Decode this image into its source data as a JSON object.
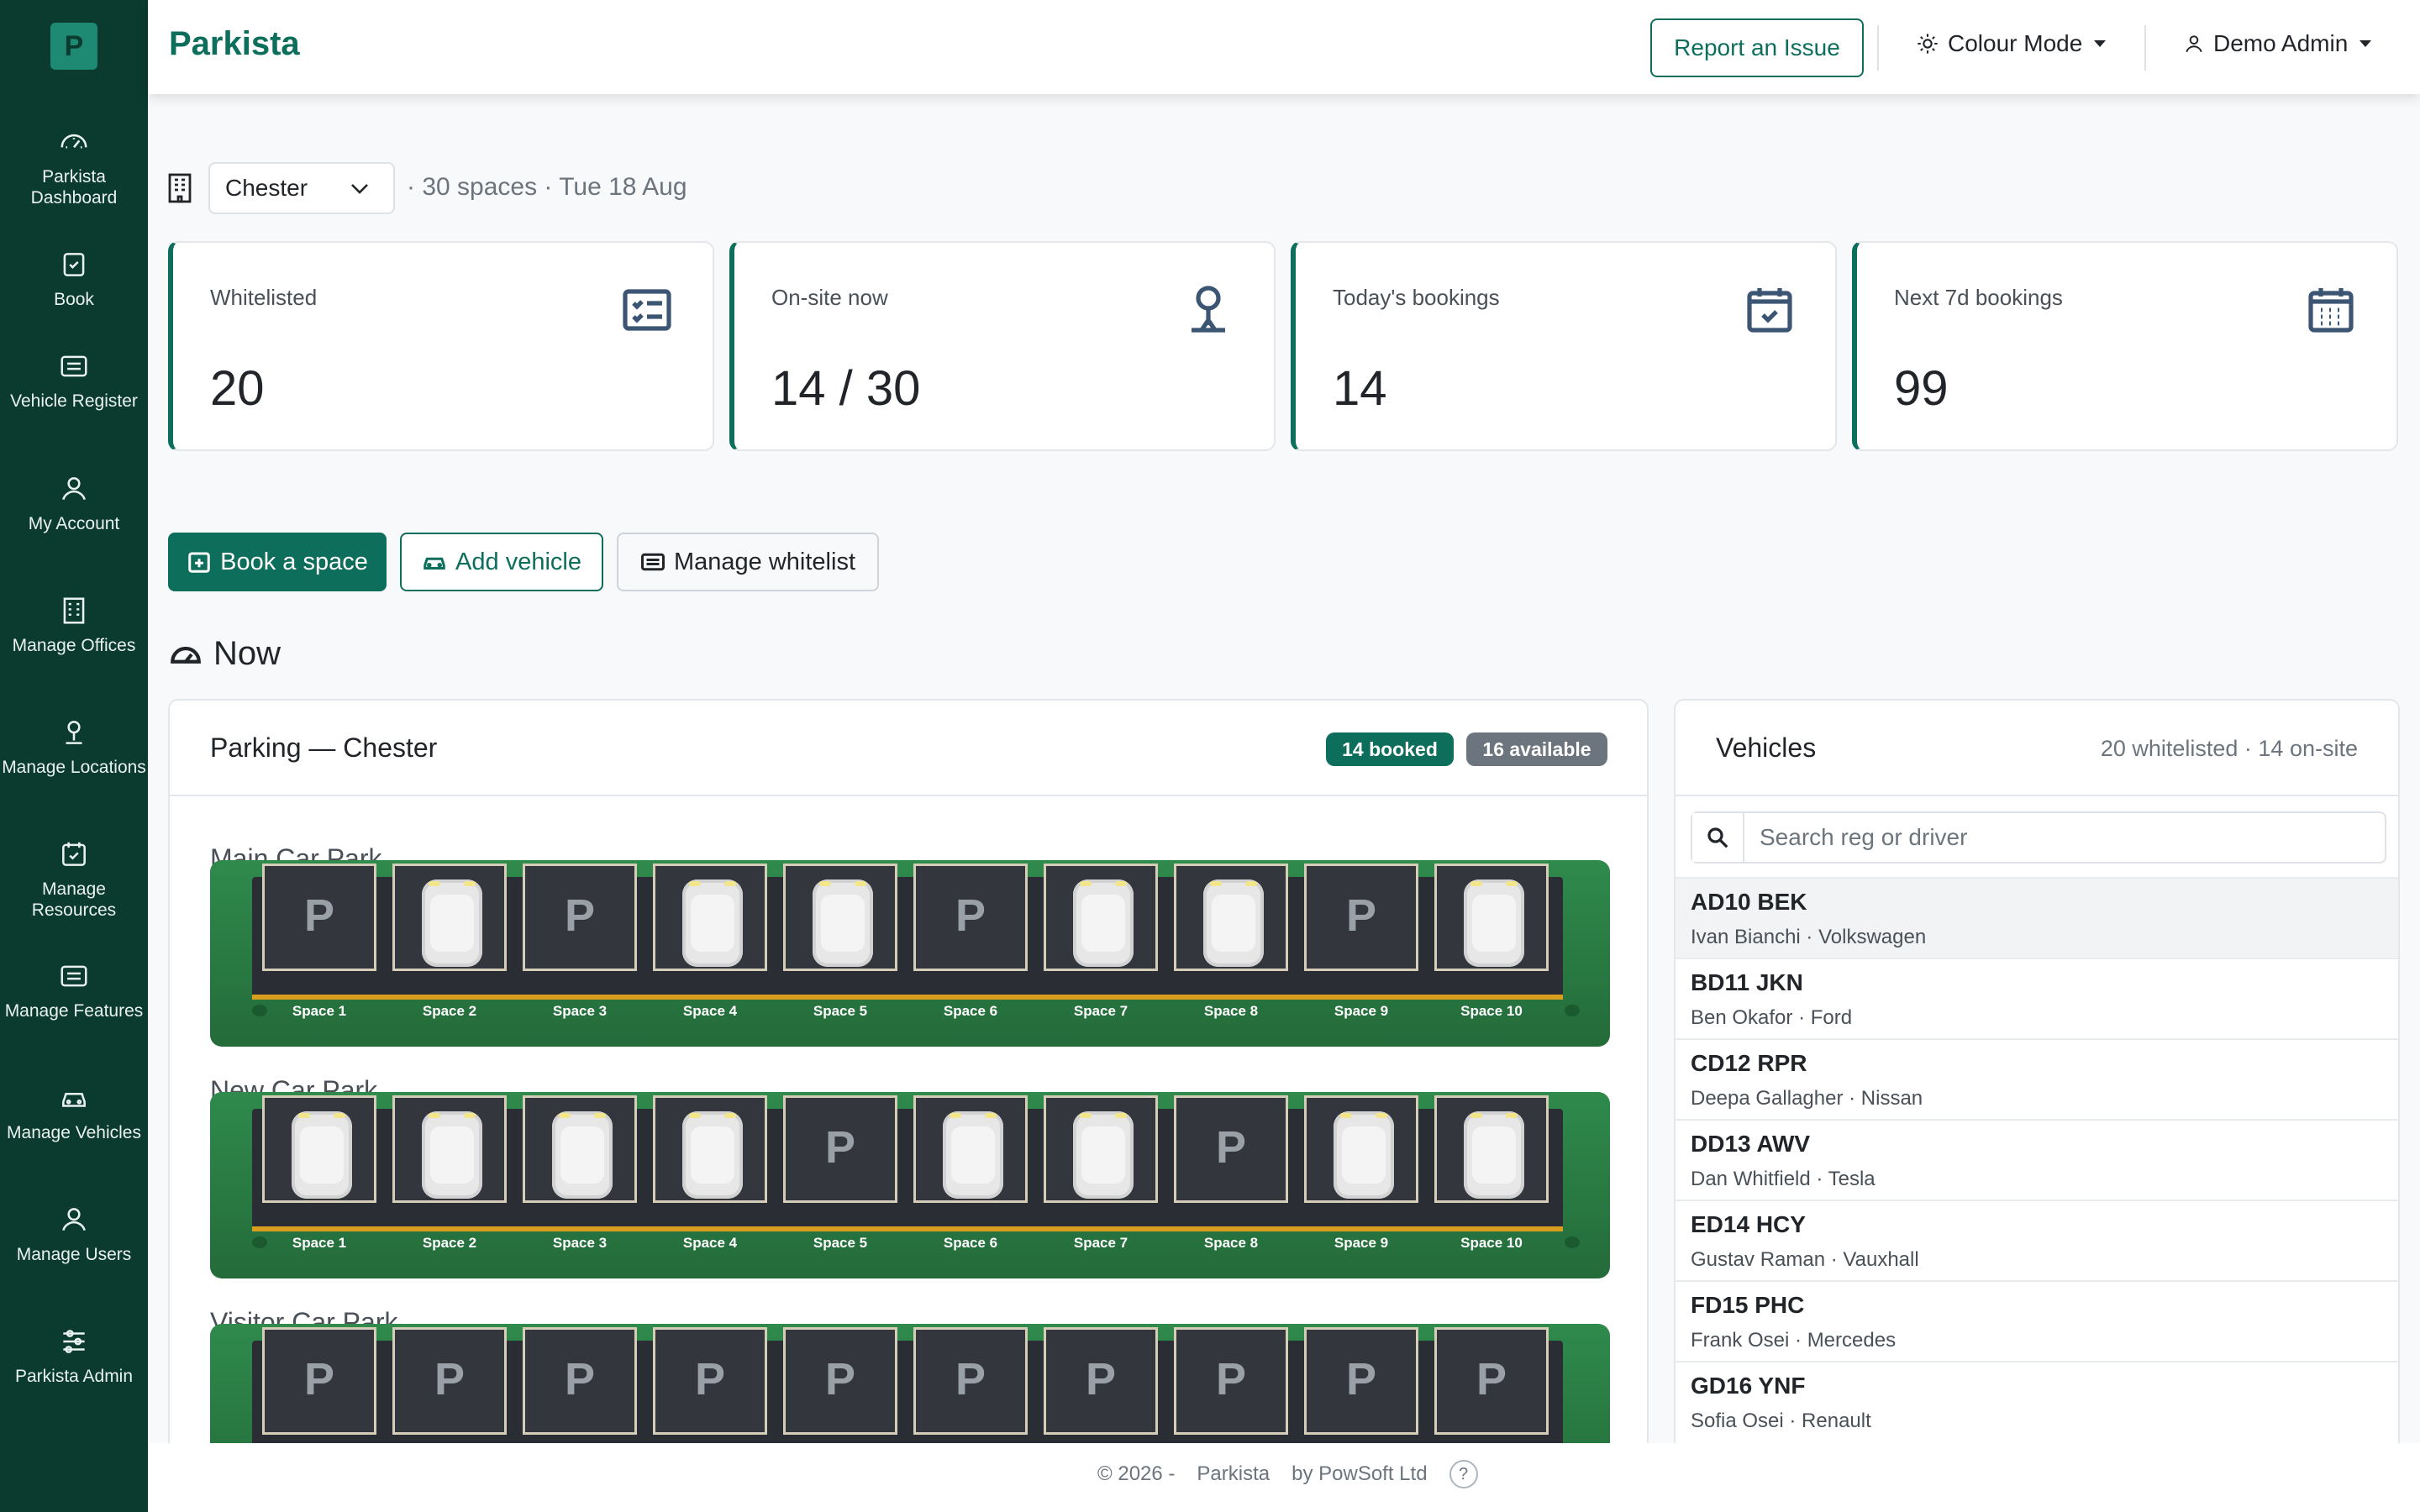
{
  "app": {
    "brand_letter": "P",
    "title": "Parkista"
  },
  "sidebar": {
    "items": [
      {
        "label": "Parkista Dashboard",
        "icon": "speedometer-icon"
      },
      {
        "label": "Book",
        "icon": "book-calendar-icon"
      },
      {
        "label": "Vehicle Register",
        "icon": "card-list-icon"
      },
      {
        "label": "My Account",
        "icon": "person-icon"
      },
      {
        "label": "Manage Offices",
        "icon": "building-icon"
      },
      {
        "label": "Manage Locations",
        "icon": "location-person-icon"
      },
      {
        "label": "Manage Resources",
        "icon": "calendar-check-icon"
      },
      {
        "label": "Manage Features",
        "icon": "card-list-icon"
      },
      {
        "label": "Manage Vehicles",
        "icon": "car-icon"
      },
      {
        "label": "Manage Users",
        "icon": "person-icon"
      },
      {
        "label": "Parkista Admin",
        "icon": "sliders-icon"
      }
    ]
  },
  "header": {
    "report": "Report an Issue",
    "colour_mode": "Colour Mode",
    "user": "Demo Admin"
  },
  "location": {
    "selected": "Chester",
    "meta": "· 30 spaces · Tue 18 Aug"
  },
  "stats": [
    {
      "label": "Whitelisted",
      "value": "20",
      "icon": "card-checklist-icon"
    },
    {
      "label": "On-site now",
      "value": "14 / 30",
      "icon": "person-pin-icon"
    },
    {
      "label": "Today's bookings",
      "value": "14",
      "icon": "calendar-check-icon"
    },
    {
      "label": "Next 7d bookings",
      "value": "99",
      "icon": "calendar-grid-icon"
    }
  ],
  "actions": {
    "book": "Book a space",
    "add_vehicle": "Add vehicle",
    "whitelist": "Manage whitelist"
  },
  "now": {
    "title": "Now"
  },
  "parking": {
    "title": "Parking — Chester",
    "booked_badge": "14 booked",
    "available_badge": "16 available",
    "lots": [
      {
        "name": "Main Car Park",
        "occupied": [
          false,
          true,
          false,
          true,
          true,
          false,
          true,
          true,
          false,
          true
        ]
      },
      {
        "name": "New Car Park",
        "occupied": [
          true,
          true,
          true,
          true,
          false,
          true,
          true,
          false,
          true,
          true
        ]
      },
      {
        "name": "Visitor Car Park",
        "occupied": [
          false,
          false,
          false,
          false,
          false,
          false,
          false,
          false,
          false,
          false
        ]
      }
    ],
    "space_labels": [
      "Space 1",
      "Space 2",
      "Space 3",
      "Space 4",
      "Space 5",
      "Space 6",
      "Space 7",
      "Space 8",
      "Space 9",
      "Space 10"
    ],
    "free_symbol": "P"
  },
  "vehicles": {
    "title": "Vehicles",
    "meta": "20 whitelisted · 14 on-site",
    "search_placeholder": "Search reg or driver",
    "rows": [
      {
        "reg": "AD10 BEK",
        "sub": "Ivan Bianchi · Volkswagen"
      },
      {
        "reg": "BD11 JKN",
        "sub": "Ben Okafor · Ford"
      },
      {
        "reg": "CD12 RPR",
        "sub": "Deepa Gallagher · Nissan"
      },
      {
        "reg": "DD13 AWV",
        "sub": "Dan Whitfield · Tesla"
      },
      {
        "reg": "ED14 HCY",
        "sub": "Gustav Raman · Vauxhall"
      },
      {
        "reg": "FD15 PHC",
        "sub": "Frank Osei · Mercedes"
      },
      {
        "reg": "GD16 YNF",
        "sub": "Sofia Osei · Renault"
      }
    ]
  },
  "footer": {
    "copy": "© 2026 -",
    "brand": "Parkista",
    "by": "by PowSoft Ltd",
    "help": "?"
  },
  "colors": {
    "brand": "#0d6e5c",
    "sidebar": "#0b3a2f",
    "available": "#6c757d",
    "lot_green": "#2f8a4c"
  }
}
